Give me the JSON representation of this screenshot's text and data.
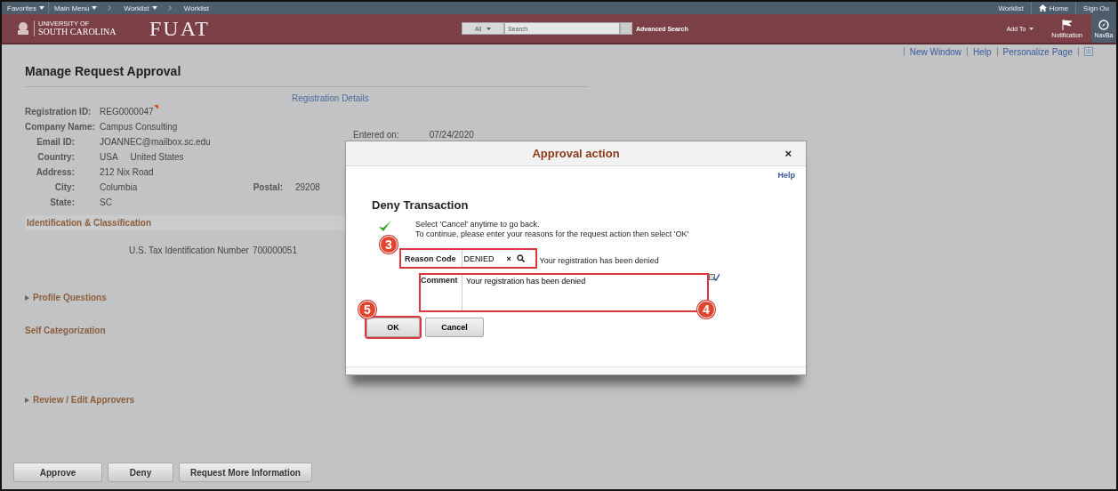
{
  "nav_bar": {
    "breadcrumbs": [
      {
        "label": "Favorites",
        "dropdown": true
      },
      {
        "label": "Main Menu",
        "dropdown": true
      },
      {
        "label": "Worklist",
        "dropdown": true
      },
      {
        "label": "Worklist",
        "dropdown": false
      }
    ],
    "links": [
      "Worklist",
      "Home",
      "Sign Ou"
    ]
  },
  "header": {
    "logo_small": "UNIVERSITY OF",
    "logo_text": "SOUTH CAROLINA",
    "app_name": "FUAT",
    "search_scope": "All",
    "search": {
      "placeholder": "Search"
    },
    "advanced_search": "Advanced Search",
    "add_to": "Add To",
    "notification": "Notification",
    "navbar": "NavBa"
  },
  "page_links": [
    "New Window",
    "Help",
    "Personalize Page"
  ],
  "page_title": "Manage Request Approval",
  "section_link": "Registration Details",
  "entered_on": {
    "label": "Entered on:",
    "value": "07/24/2020"
  },
  "fields": [
    {
      "label": "Registration ID:",
      "values": [
        "REG0000047"
      ]
    },
    {
      "label": "Company Name:",
      "values": [
        "Campus Consulting"
      ]
    },
    {
      "label": "Email ID:",
      "values": [
        "JOANNEC@mailbox.sc.edu"
      ]
    },
    {
      "label": "Country:",
      "values": [
        "USA",
        "United States"
      ]
    },
    {
      "label": "Address:",
      "values": [
        "212 Nix Road"
      ]
    },
    {
      "label": "City:",
      "values": [
        "Columbia"
      ],
      "extra": {
        "label": "Postal:",
        "value": "29208"
      }
    },
    {
      "label": "State:",
      "values": [
        "SC"
      ]
    }
  ],
  "identification": {
    "title": "Identification & Classification",
    "tax_label": "U.S. Tax Identification Number",
    "tax_value": "700000051"
  },
  "sections": [
    {
      "kind": "collapsible",
      "title": "Profile Questions",
      "expanded": false
    },
    {
      "kind": "heading",
      "title": "Self Categorization"
    },
    {
      "kind": "collapsible",
      "title": "Review / Edit Approvers",
      "expanded": false
    }
  ],
  "actions": [
    "Approve",
    "Deny",
    "Request More Information"
  ],
  "dialog": {
    "title": "Approval action",
    "close": "×",
    "help": "Help",
    "heading": "Deny Transaction",
    "messages": [
      "Select 'Cancel' anytime to go back.",
      "To continue, please enter your reasons for the request action then select 'OK'"
    ],
    "reason_code": {
      "label": "Reason Code",
      "value": "DENIED",
      "clear": "×",
      "description": "Your registration has been denied",
      "callout": "3"
    },
    "comment": {
      "label": "Comment",
      "value": "Your registration has been denied",
      "callout": "4"
    },
    "buttons": [
      {
        "label": "OK",
        "callout": "5"
      },
      {
        "label": "Cancel"
      }
    ]
  }
}
